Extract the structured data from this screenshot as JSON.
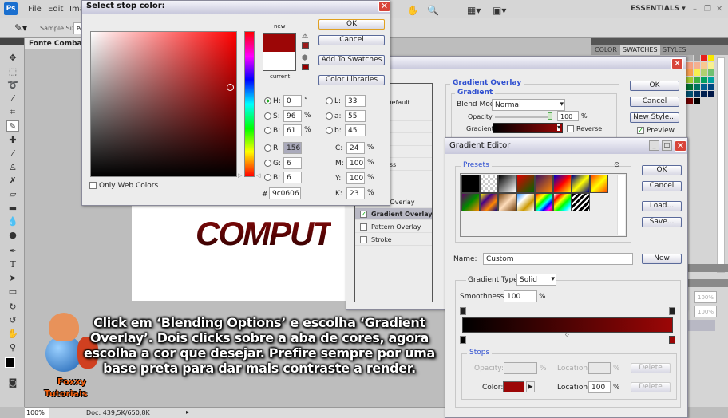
{
  "app": {
    "logo": "Ps",
    "menu": [
      "File",
      "Edit",
      "Ima"
    ],
    "workspace": "ESSENTIALS",
    "window_controls": [
      "–",
      "❐",
      "✕"
    ]
  },
  "options": {
    "sample_size_label": "Sample Size:",
    "sample_size_value": "Po"
  },
  "document": {
    "tab_title": "Fonte Combat A",
    "canvas_text": "COMPUT",
    "zoom": "100%",
    "doc_info": "Doc: 439,5K/650,8K"
  },
  "panels": {
    "tabs": [
      "COLOR",
      "SWATCHES",
      "STYLES"
    ],
    "active_tab": "SWATCHES",
    "opacity_1": "100%",
    "opacity_2": "100%",
    "swatches": [
      "#b0b0b0",
      "#9a9a9a",
      "#e8201c",
      "#f8e800",
      "#f4a080",
      "#f4b090",
      "#f8c890",
      "#f8f090",
      "#f8a050",
      "#f8f050",
      "#b0d070",
      "#70c070",
      "#a0c830",
      "#40b040",
      "#00a060",
      "#00a0a0",
      "#007030",
      "#007060",
      "#006090",
      "#004880",
      "#005070",
      "#003060",
      "#002050",
      "#001848",
      "#700000",
      "#000000"
    ]
  },
  "color_picker": {
    "title": "Select stop color:",
    "new_label": "new",
    "current_label": "current",
    "new_color": "#9c0606",
    "current_color": "#ffffff",
    "ok": "OK",
    "cancel": "Cancel",
    "add_to_swatches": "Add To Swatches",
    "color_libraries": "Color Libraries",
    "only_web_colors": "Only Web Colors",
    "H": "0",
    "S": "96",
    "B": "61",
    "R": "156",
    "G": "6",
    "Bb": "6",
    "L": "33",
    "a": "55",
    "b": "45",
    "C": "24",
    "M": "100",
    "Y": "100",
    "K": "23",
    "hex": "9c0606",
    "deg": "°",
    "pct": "%",
    "hash": "#",
    "selected_mode": "H"
  },
  "layer_style": {
    "section": "Gradient Overlay",
    "subsection": "Gradient",
    "blend_mode_label": "Blend Mode:",
    "blend_mode": "Normal",
    "opacity_label": "Opacity:",
    "opacity": "100",
    "gradient_label": "Gradient:",
    "reverse": "Reverse",
    "ok": "OK",
    "cancel": "Cancel",
    "new_style": "New Style...",
    "preview": "Preview",
    "preview_checked": true,
    "list": [
      {
        "label": "ons: Default",
        "checked": null
      },
      {
        "label": "ow",
        "checked": false
      },
      {
        "label": "low",
        "checked": false
      },
      {
        "label": "",
        "checked": false
      },
      {
        "label": "",
        "checked": false
      },
      {
        "label": "Emboss",
        "checked": false
      },
      {
        "label": "",
        "checked": false
      },
      {
        "label": "",
        "checked": false
      },
      {
        "label": "Color Overlay",
        "checked": false
      },
      {
        "label": "Gradient Overlay",
        "checked": true
      },
      {
        "label": "Pattern Overlay",
        "checked": false
      },
      {
        "label": "Stroke",
        "checked": false
      }
    ]
  },
  "gradient_editor": {
    "title": "Gradient Editor",
    "presets_label": "Presets",
    "ok": "OK",
    "cancel": "Cancel",
    "load": "Load...",
    "save": "Save...",
    "name_label": "Name:",
    "name": "Custom",
    "new": "New",
    "type_label": "Gradient Type:",
    "type": "Solid",
    "smoothness_label": "Smoothness:",
    "smoothness": "100",
    "stops_label": "Stops",
    "opacity_label": "Opacity:",
    "location_label": "Location:",
    "delete": "Delete",
    "color_label": "Color:",
    "stop_color": "#9c0606",
    "location": "100",
    "pct": "%",
    "gradient_start": "#000000",
    "gradient_end": "#9c0606"
  },
  "caption": "Click em ‘Blending Options’ e escolha ‘Gradient Overlay’. Dois clicks sobre a aba de cores, agora escolha a cor que desejar. Prefire sempre por uma base preta para dar mais contraste a render.",
  "logo": {
    "line1": "Foxxy",
    "line2": "Tutoriais"
  }
}
